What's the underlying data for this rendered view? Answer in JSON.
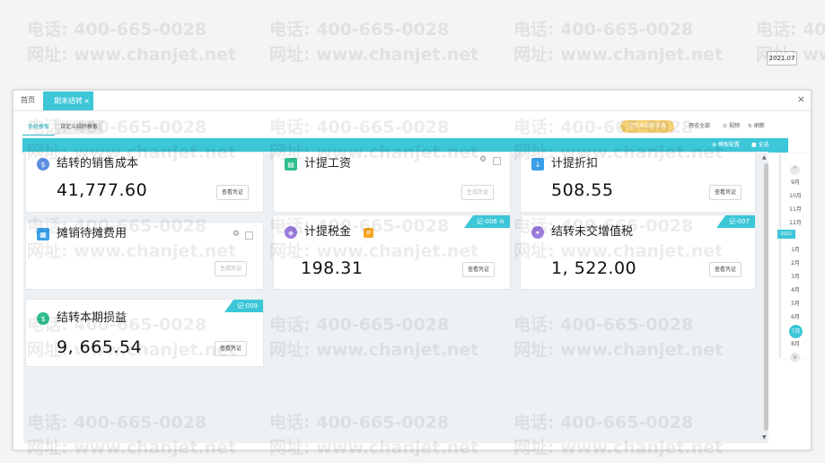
{
  "watermark": {
    "phone": "电话: 400-665-0028",
    "site": "网址: www.chanjet.net"
  },
  "titlebar": {
    "home_tab": "首页",
    "active_tab": "期末结转",
    "tab_close": "×",
    "window_close": "×"
  },
  "toolbar": {
    "tab_system": "系统模板",
    "tab_custom": "自定义结转模板",
    "warning_pill": "存在未结转业务",
    "btn_preview": "预览全部",
    "btn_video": "视频",
    "btn_refresh": "刷新"
  },
  "bluebar": {
    "btn_expand": "模板配置",
    "btn_select_all": "全选"
  },
  "period": "2021.07",
  "cards": [
    {
      "title": "结转的销售成本",
      "value": "41,777.60",
      "button": "查看凭证",
      "ribbon": "",
      "icon": "money-bag-icon"
    },
    {
      "title": "计提工资",
      "value": "",
      "button": "生成凭证",
      "ribbon": "",
      "icon": "payroll-icon"
    },
    {
      "title": "计提折扣",
      "value": "508.55",
      "button": "查看凭证",
      "ribbon": "",
      "icon": "depreciation-icon"
    },
    {
      "title": "摊销待摊费用",
      "value": "",
      "button": "生成凭证",
      "ribbon": "",
      "icon": "grid-icon"
    },
    {
      "title": "计提税金",
      "value": "198.31",
      "button": "查看凭证",
      "ribbon": "记-006",
      "icon": "tax-icon"
    },
    {
      "title": "结转未交增值税",
      "value": "1, 522.00",
      "button": "查看凭证",
      "ribbon": "记-007",
      "icon": "vat-icon"
    },
    {
      "title": "结转本期损益",
      "value": "9, 665.54",
      "button": "查看凭证",
      "ribbon": "记-009",
      "icon": "profit-icon"
    }
  ],
  "month_rail": {
    "up": "^",
    "down": "v",
    "year_tag": "2021",
    "months": [
      "9月",
      "10月",
      "11月",
      "12月",
      "1月",
      "2月",
      "3月",
      "4月",
      "5月",
      "6月",
      "7月",
      "8月"
    ],
    "active_month": "7月"
  },
  "colors": {
    "accent": "#3cc6d8",
    "warning": "#f6d277",
    "tax_badge": "#f5a623"
  }
}
